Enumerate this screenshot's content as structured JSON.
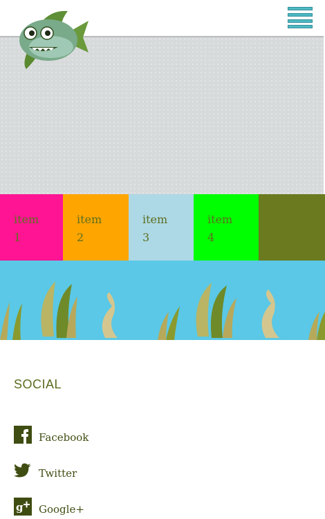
{
  "menu": {
    "icon": "hamburger-menu-icon"
  },
  "logo": {
    "icon": "fish-mascot-logo"
  },
  "items": [
    {
      "word": "item",
      "number": "1",
      "color": "#ff1493"
    },
    {
      "word": "item",
      "number": "2",
      "color": "#ffa500"
    },
    {
      "word": "item",
      "number": "3",
      "color": "#add8e6"
    },
    {
      "word": "item",
      "number": "4",
      "color": "#00ff00"
    },
    {
      "word": "",
      "number": "",
      "color": "#6b7a1e"
    }
  ],
  "footer": {
    "social_title": "SOCIAL",
    "links": [
      {
        "label": "Facebook",
        "icon": "facebook-icon"
      },
      {
        "label": "Twitter",
        "icon": "twitter-icon"
      },
      {
        "label": "Google+",
        "icon": "google-plus-icon"
      }
    ]
  },
  "colors": {
    "seaweed_band": "#5ac8e6",
    "hero": "#d7dadb",
    "accent_green": "#5d6f1f"
  }
}
